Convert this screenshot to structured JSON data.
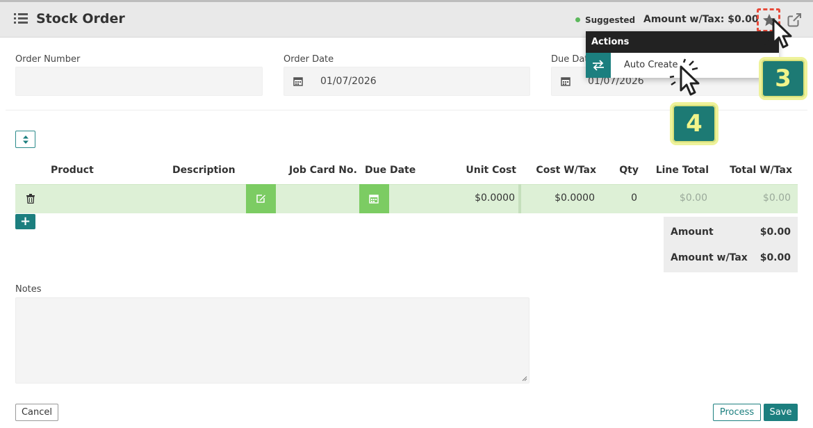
{
  "header": {
    "title": "Stock Order",
    "status": "Suggested",
    "amount_with_tax": "Amount w/Tax: $0.00"
  },
  "form": {
    "order_number": {
      "label": "Order Number",
      "value": ""
    },
    "order_date": {
      "label": "Order Date",
      "value": "01/07/2026"
    },
    "due_date": {
      "label": "Due Dat",
      "value": "01/07/2026"
    }
  },
  "table": {
    "columns": [
      "Product",
      "Description",
      "Job Card No.",
      "Due Date",
      "Unit Cost",
      "Cost W/Tax",
      "Qty",
      "Line Total",
      "Total W/Tax"
    ],
    "row": {
      "unit_cost": "$0.0000",
      "cost_with_tax": "$0.0000",
      "qty": "0",
      "line_total": "$0.00",
      "total_with_tax": "$0.00"
    }
  },
  "totals": {
    "amount_label": "Amount",
    "amount_value": "$0.00",
    "amount_tax_label": "Amount w/Tax",
    "amount_tax_value": "$0.00"
  },
  "notes": {
    "label": "Notes",
    "value": ""
  },
  "buttons": {
    "cancel": "Cancel",
    "process": "Process",
    "save": "Save",
    "add": "+"
  },
  "actions_menu": {
    "title": "Actions",
    "items": [
      {
        "label": "Auto Create",
        "icon": "swap-arrows-icon"
      }
    ]
  },
  "annotations": {
    "step_3": "3",
    "step_4": "4"
  },
  "colors": {
    "accent": "#1c7f7f",
    "row_bg": "#ddf0d6",
    "green_button": "#7ccc63",
    "status_dot": "#5cb85c",
    "badge_bg": "#1d7a74",
    "badge_text": "#f2f48a",
    "highlight_border": "#e84a3a"
  }
}
